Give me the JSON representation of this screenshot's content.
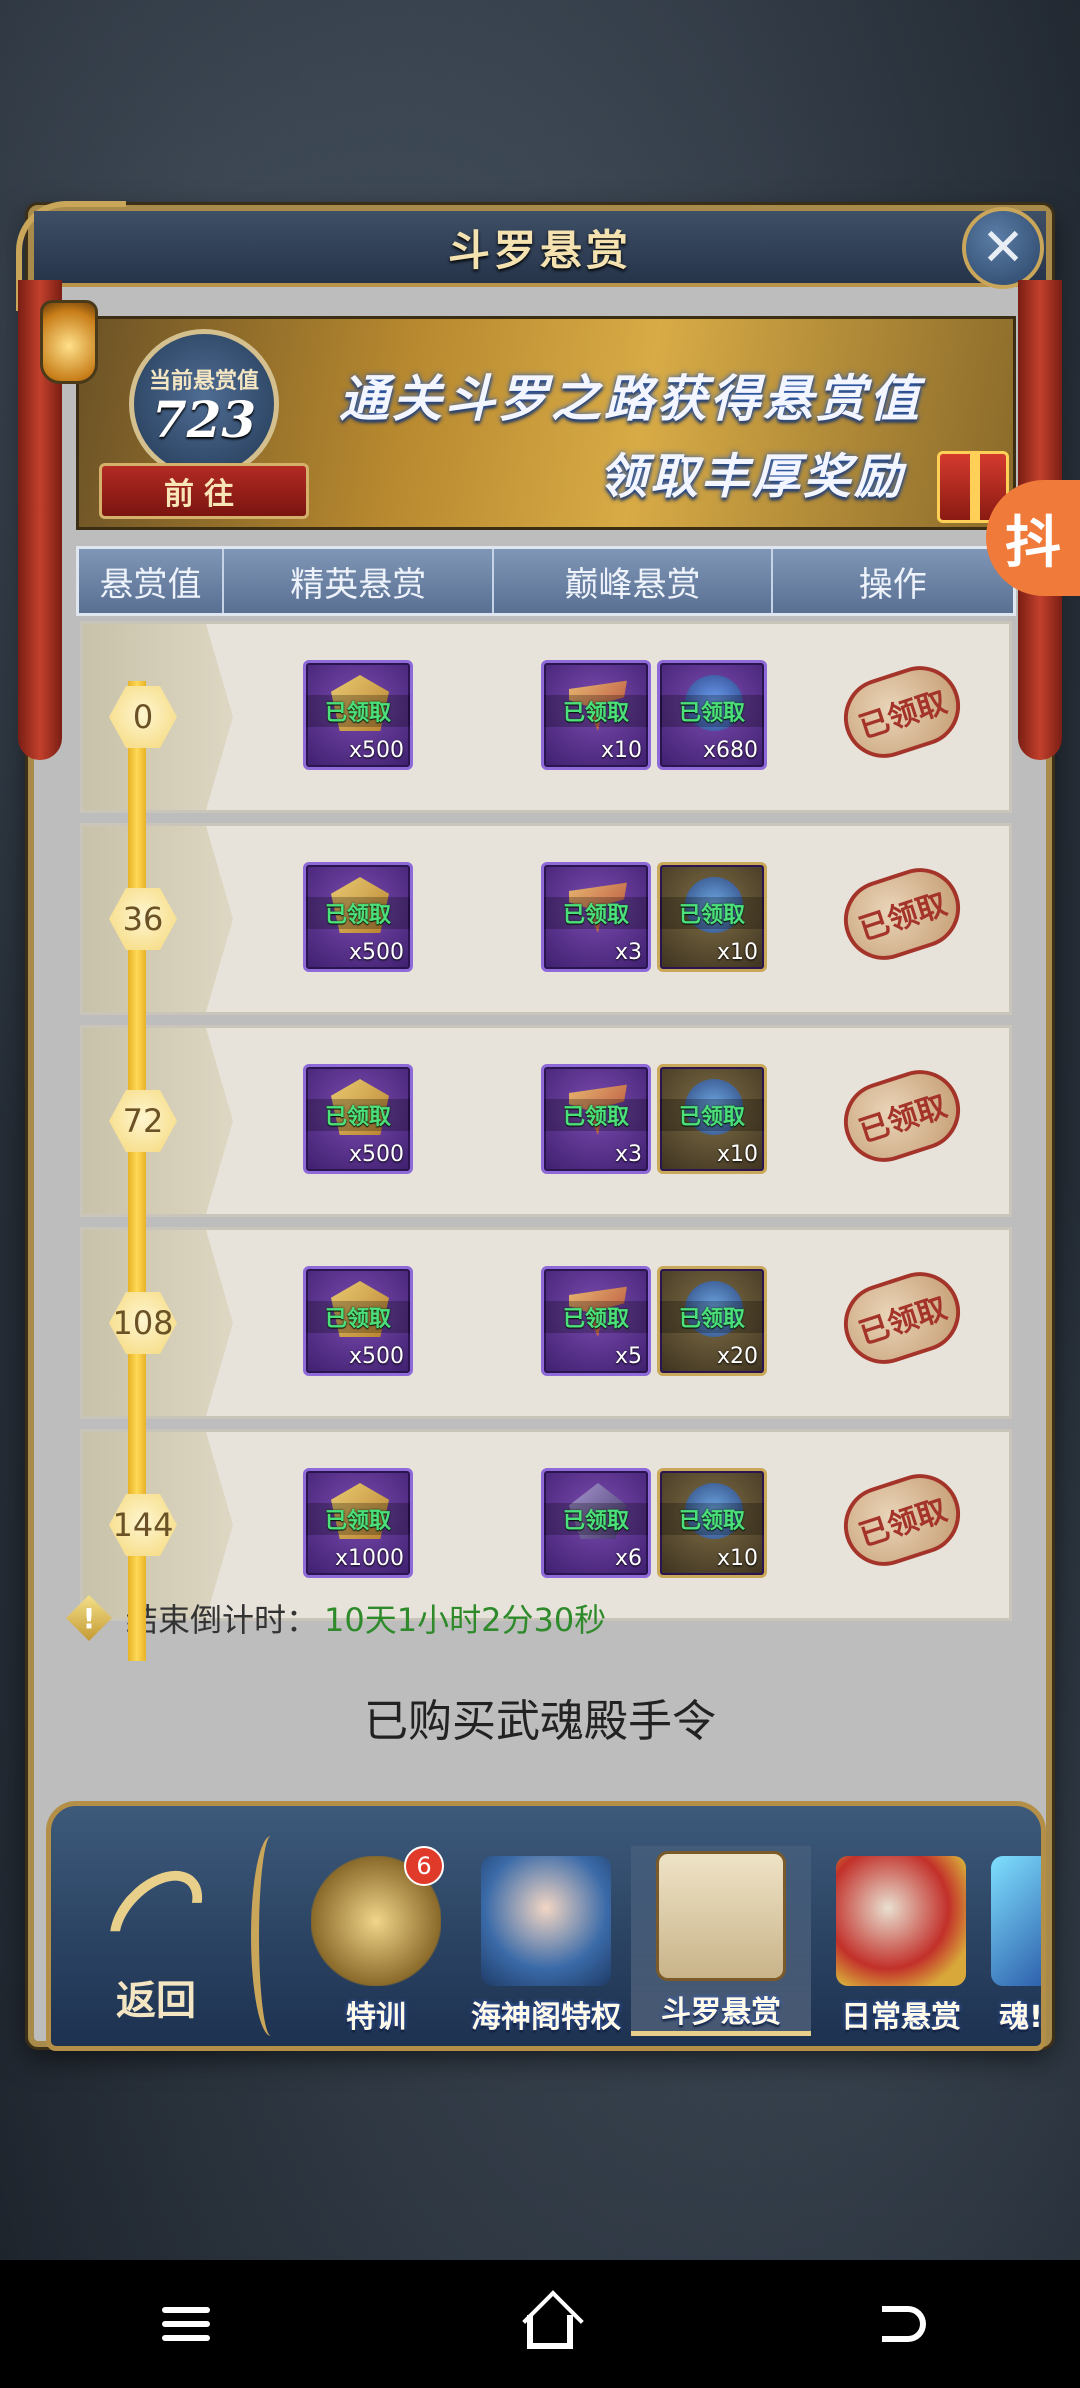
{
  "title": "斗罗悬赏",
  "banner": {
    "current_label": "当前悬赏值",
    "current_value": "723",
    "goto_label": "前往",
    "line1": "通关斗罗之路获得悬赏值",
    "line2": "领取丰厚奖励"
  },
  "table": {
    "headers": [
      "悬赏值",
      "精英悬赏",
      "巅峰悬赏",
      "操作"
    ],
    "claimed_text": "已领取",
    "rows": [
      {
        "threshold": "0",
        "elite": {
          "qty": "x500",
          "icon": "gold-chip-icon"
        },
        "peak": [
          {
            "qty": "x10",
            "icon": "sword-icon",
            "tier": "purple"
          },
          {
            "qty": "x680",
            "icon": "blue-orb-icon",
            "tier": "purple"
          }
        ],
        "action": "已领取"
      },
      {
        "threshold": "36",
        "elite": {
          "qty": "x500",
          "icon": "gold-chip-icon"
        },
        "peak": [
          {
            "qty": "x3",
            "icon": "sword-icon",
            "tier": "purple"
          },
          {
            "qty": "x10",
            "icon": "blue-orb-icon",
            "tier": "gold"
          }
        ],
        "action": "已领取"
      },
      {
        "threshold": "72",
        "elite": {
          "qty": "x500",
          "icon": "gold-chip-icon"
        },
        "peak": [
          {
            "qty": "x3",
            "icon": "sword-icon",
            "tier": "purple"
          },
          {
            "qty": "x10",
            "icon": "blue-orb-icon",
            "tier": "gold"
          }
        ],
        "action": "已领取"
      },
      {
        "threshold": "108",
        "elite": {
          "qty": "x500",
          "icon": "gold-chip-icon"
        },
        "peak": [
          {
            "qty": "x5",
            "icon": "sword-icon",
            "tier": "purple"
          },
          {
            "qty": "x20",
            "icon": "blue-orb-icon",
            "tier": "gold"
          }
        ],
        "action": "已领取"
      },
      {
        "threshold": "144",
        "elite": {
          "qty": "x1000",
          "icon": "gold-chip-icon"
        },
        "peak": [
          {
            "qty": "x6",
            "icon": "gem-icon",
            "tier": "purple"
          },
          {
            "qty": "x10",
            "icon": "blue-orb-icon",
            "tier": "gold"
          }
        ],
        "action": "已领取"
      }
    ]
  },
  "countdown": {
    "label": "结束倒计时：",
    "value": "10天1小时2分30秒"
  },
  "purchase_status": "已购买武魂殿手令",
  "tabbar": {
    "back_label": "返回",
    "tabs": [
      {
        "label": "特训",
        "badge": "6",
        "icon": "shield-sword-icon"
      },
      {
        "label": "海神阁特权",
        "icon": "goddess-portrait-icon"
      },
      {
        "label": "斗罗悬赏",
        "icon": "wanted-poster-icon",
        "active": true
      },
      {
        "label": "日常悬赏",
        "icon": "scroll-coins-icon"
      },
      {
        "label": "魂!",
        "icon": "crystal-icon"
      }
    ]
  },
  "float_button": "抖",
  "colors": {
    "accent_gold": "#c9a65a",
    "claimed_green": "#4ce07a",
    "countdown_green": "#2e8a2b",
    "stamp_red": "#a4342a"
  }
}
